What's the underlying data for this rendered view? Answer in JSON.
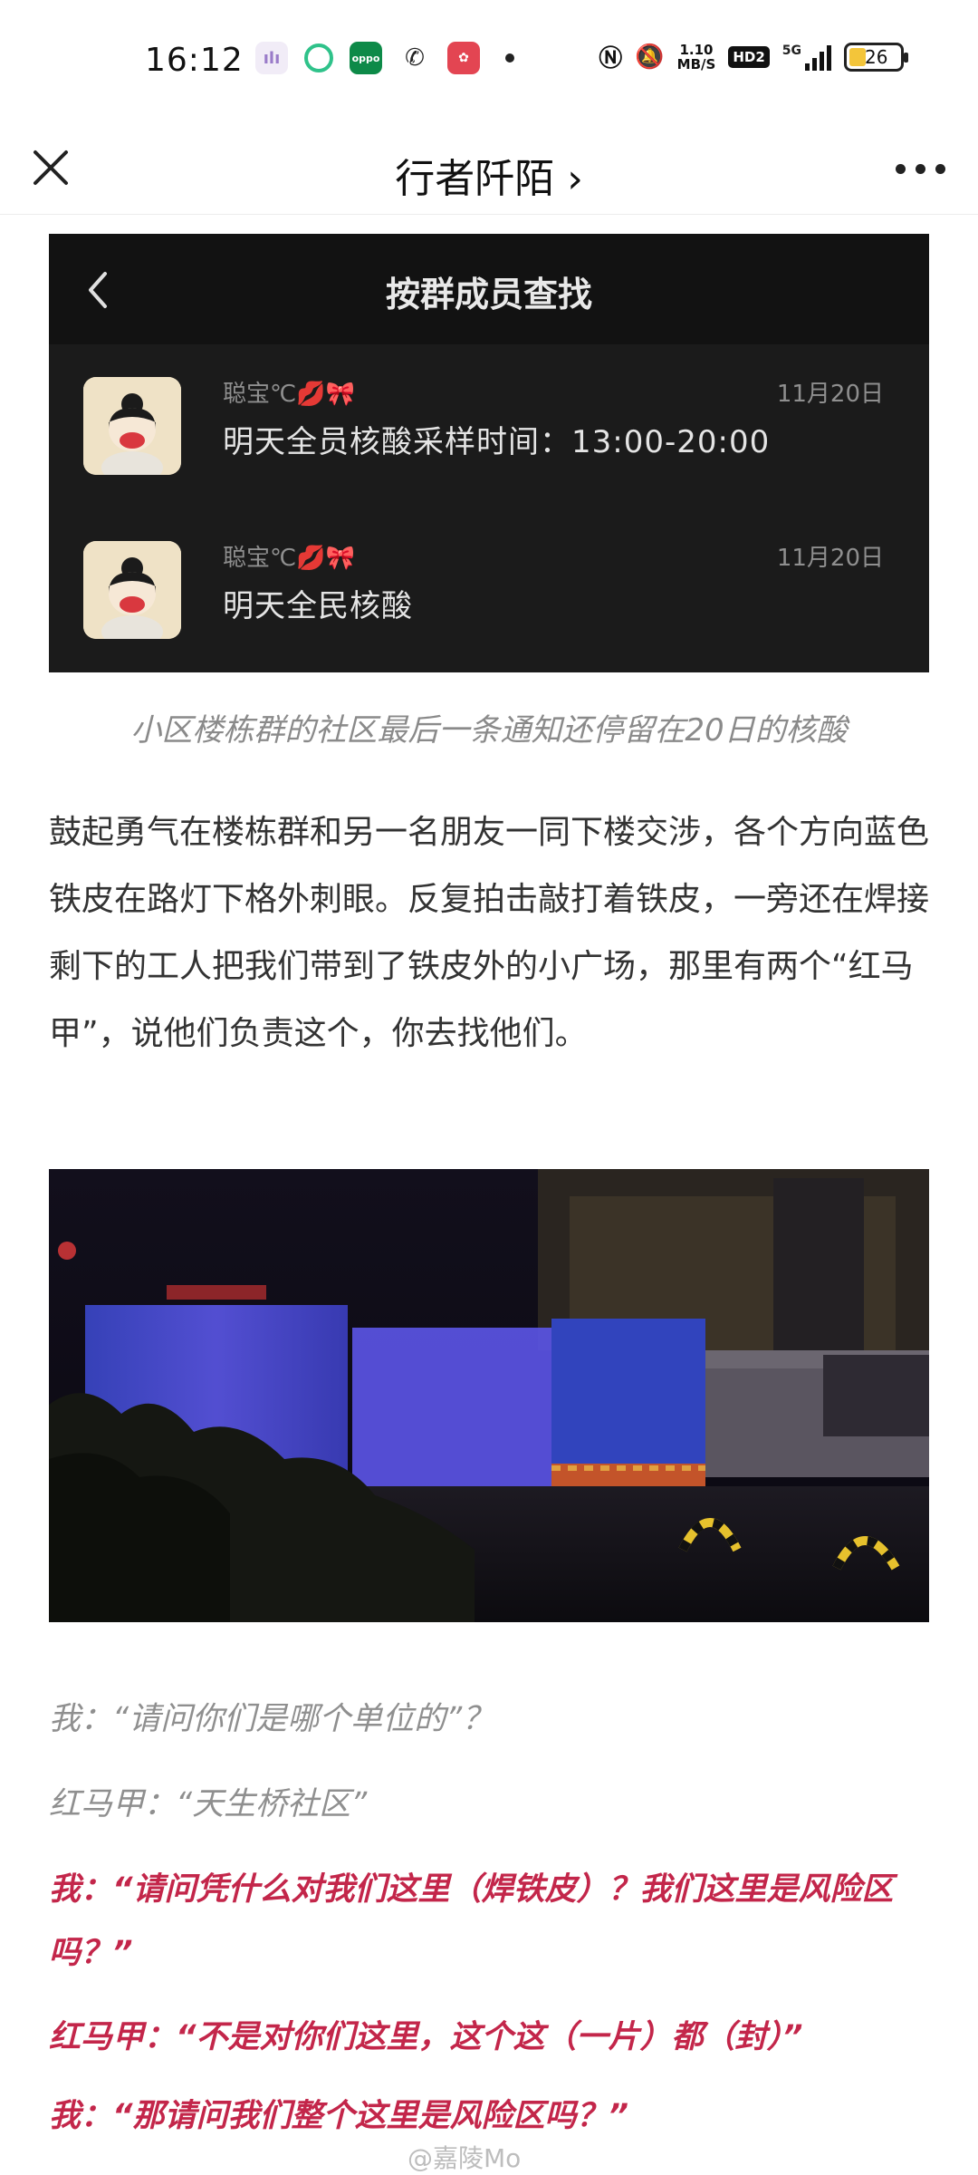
{
  "status_bar": {
    "time": "16:12",
    "net_speed_value": "1.10",
    "net_speed_unit": "MB/S",
    "hd_label": "HD2",
    "network_label": "5G",
    "battery_level": "26",
    "app_oppo_label": "oppo"
  },
  "nav": {
    "title": "行者阡陌 ›"
  },
  "embedded": {
    "title": "按群成员查找",
    "items": [
      {
        "name": "聪宝℃💋🎀",
        "date": "11月20日",
        "message": "明天全员核酸采样时间：13:00-20:00"
      },
      {
        "name": "聪宝℃💋🎀",
        "date": "11月20日",
        "message": "明天全民核酸"
      }
    ]
  },
  "caption": "小区楼栋群的社区最后一条通知还停留在20日的核酸",
  "paragraph": "鼓起勇气在楼栋群和另一名朋友一同下楼交涉，各个方向蓝色铁皮在路灯下格外刺眼。反复拍击敲打着铁皮，一旁还在焊接剩下的工人把我们带到了铁皮外的小广场，那里有两个“红马甲”，说他们负责这个，你去找他们。",
  "dialogue": [
    {
      "text": "我：“请问你们是哪个单位的”？",
      "style": "grey"
    },
    {
      "text": "红马甲：“天生桥社区”",
      "style": "grey"
    },
    {
      "text": "我：“请问凭什么对我们这里（焊铁皮）？我们这里是风险区吗？”",
      "style": "red"
    },
    {
      "text": "红马甲：“不是对你们这里，这个这（一片）都（封）”",
      "style": "red"
    },
    {
      "text": "我：“那请问我们整个这里是风险区吗？”",
      "style": "red"
    }
  ],
  "watermark": "@嘉陵Mo",
  "colors": {
    "accent_red": "#c3264a",
    "muted_grey": "#8f8f8f",
    "dark_card": "#161616"
  }
}
